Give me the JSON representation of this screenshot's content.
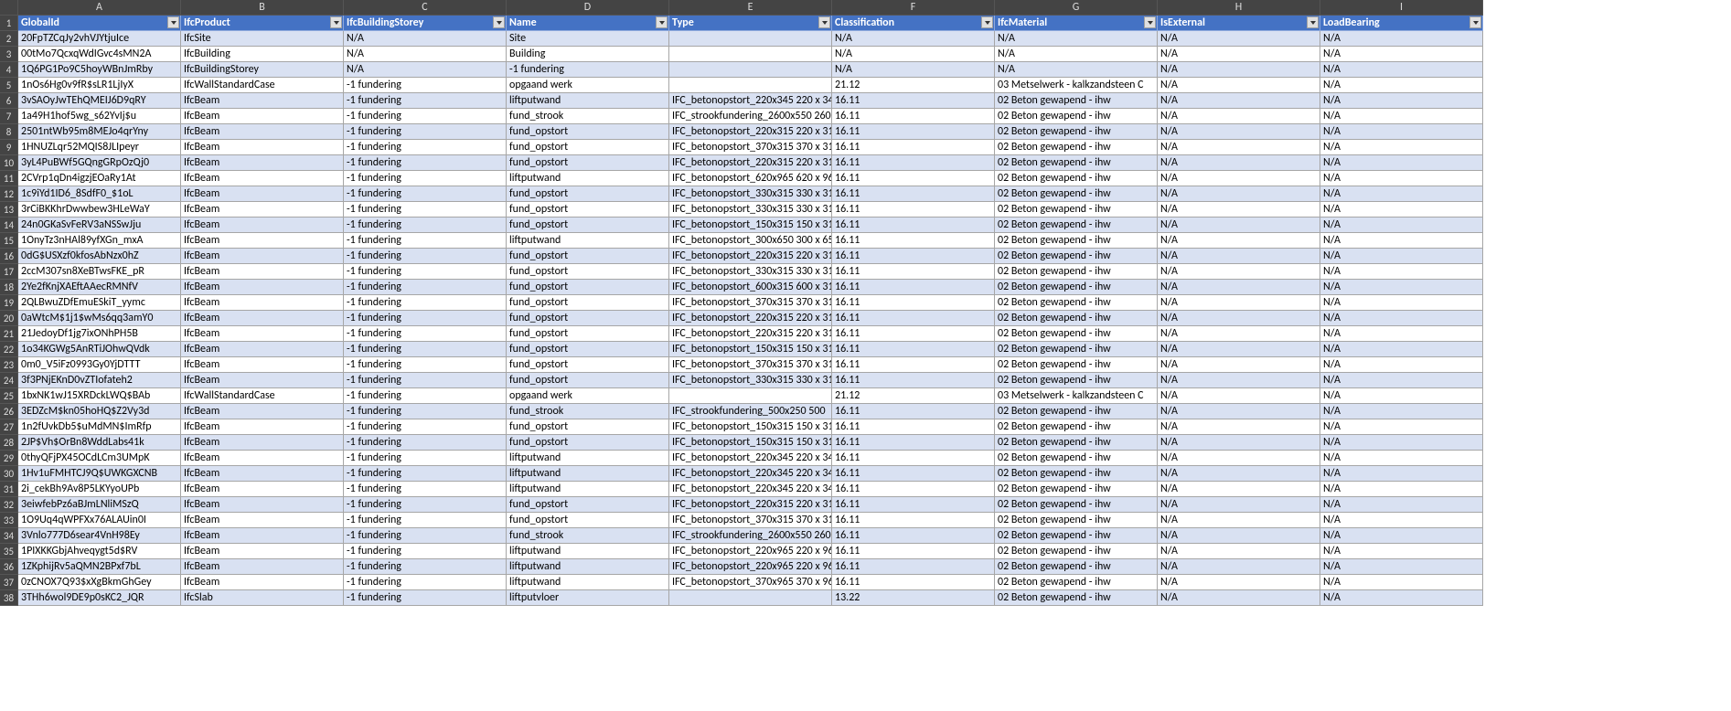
{
  "column_letters": [
    "A",
    "B",
    "C",
    "D",
    "E",
    "F",
    "G",
    "H",
    "I"
  ],
  "headers": [
    "GlobalId",
    "IfcProduct",
    "IfcBuildingStorey",
    "Name",
    "Type",
    "Classification",
    "IfcMaterial",
    "IsExternal",
    "LoadBearing"
  ],
  "rows": [
    {
      "n": 2,
      "v": [
        "20FpTZCqJy2vhVJYtjuIce",
        "IfcSite",
        "N/A",
        "Site",
        "",
        "N/A",
        "N/A",
        "N/A",
        "N/A"
      ]
    },
    {
      "n": 3,
      "v": [
        "00tMo7QcxqWdIGvc4sMN2A",
        "IfcBuilding",
        "N/A",
        "Building",
        "",
        "N/A",
        "N/A",
        "N/A",
        "N/A"
      ]
    },
    {
      "n": 4,
      "v": [
        "1Q6PG1Po9C5hoyWBnJmRby",
        "IfcBuildingStorey",
        "N/A",
        "-1 fundering",
        "",
        "N/A",
        "N/A",
        "N/A",
        "N/A"
      ]
    },
    {
      "n": 5,
      "v": [
        "1nOs6Hg0v9fR$sLR1LjIyX",
        "IfcWallStandardCase",
        "-1 fundering",
        "opgaand werk",
        "",
        "21.12",
        "03 Metselwerk - kalkzandsteen C",
        "N/A",
        "N/A"
      ]
    },
    {
      "n": 6,
      "v": [
        "3vSAOyJwTEhQMEIJ6D9qRY",
        "IfcBeam",
        "-1 fundering",
        "liftputwand",
        "IFC_betonopstort_220x345 220 x 34",
        "16.11",
        "02 Beton gewapend - ihw",
        "N/A",
        "N/A"
      ]
    },
    {
      "n": 7,
      "v": [
        "1a49H1hof5wg_s62YvIj$u",
        "IfcBeam",
        "-1 fundering",
        "fund_strook",
        "IFC_strookfundering_2600x550 260",
        "16.11",
        "02 Beton gewapend - ihw",
        "N/A",
        "N/A"
      ]
    },
    {
      "n": 8,
      "v": [
        "2501ntWb95m8MEJo4qrYny",
        "IfcBeam",
        "-1 fundering",
        "fund_opstort",
        "IFC_betonopstort_220x315 220 x 31",
        "16.11",
        "02 Beton gewapend - ihw",
        "N/A",
        "N/A"
      ]
    },
    {
      "n": 9,
      "v": [
        "1HNUZLqr52MQIS8JLIpeyr",
        "IfcBeam",
        "-1 fundering",
        "fund_opstort",
        "IFC_betonopstort_370x315 370 x 31",
        "16.11",
        "02 Beton gewapend - ihw",
        "N/A",
        "N/A"
      ]
    },
    {
      "n": 10,
      "v": [
        "3yL4PuBWf5GQngGRpOzQj0",
        "IfcBeam",
        "-1 fundering",
        "fund_opstort",
        "IFC_betonopstort_220x315 220 x 31",
        "16.11",
        "02 Beton gewapend - ihw",
        "N/A",
        "N/A"
      ]
    },
    {
      "n": 11,
      "v": [
        "2CVrp1qDn4igzjEOaRy1At",
        "IfcBeam",
        "-1 fundering",
        "liftputwand",
        "IFC_betonopstort_620x965 620 x 96",
        "16.11",
        "02 Beton gewapend - ihw",
        "N/A",
        "N/A"
      ]
    },
    {
      "n": 12,
      "v": [
        "1c9iYd1ID6_8SdfF0_$1oL",
        "IfcBeam",
        "-1 fundering",
        "fund_opstort",
        "IFC_betonopstort_330x315 330 x 31",
        "16.11",
        "02 Beton gewapend - ihw",
        "N/A",
        "N/A"
      ]
    },
    {
      "n": 13,
      "v": [
        "3rCiBKKhrDwwbew3HLeWaY",
        "IfcBeam",
        "-1 fundering",
        "fund_opstort",
        "IFC_betonopstort_330x315 330 x 31",
        "16.11",
        "02 Beton gewapend - ihw",
        "N/A",
        "N/A"
      ]
    },
    {
      "n": 14,
      "v": [
        "24n0GKaSvFeRV3aNSSwJju",
        "IfcBeam",
        "-1 fundering",
        "fund_opstort",
        "IFC_betonopstort_150x315 150 x 31",
        "16.11",
        "02 Beton gewapend - ihw",
        "N/A",
        "N/A"
      ]
    },
    {
      "n": 15,
      "v": [
        "1OnyTz3nHAl89yfXGn_mxA",
        "IfcBeam",
        "-1 fundering",
        "liftputwand",
        "IFC_betonopstort_300x650 300 x 65",
        "16.11",
        "02 Beton gewapend - ihw",
        "N/A",
        "N/A"
      ]
    },
    {
      "n": 16,
      "v": [
        "0dG$USXzf0kfosAbNzx0hZ",
        "IfcBeam",
        "-1 fundering",
        "fund_opstort",
        "IFC_betonopstort_220x315 220 x 31",
        "16.11",
        "02 Beton gewapend - ihw",
        "N/A",
        "N/A"
      ]
    },
    {
      "n": 17,
      "v": [
        "2ccM307sn8XeBTwsFKE_pR",
        "IfcBeam",
        "-1 fundering",
        "fund_opstort",
        "IFC_betonopstort_330x315 330 x 31",
        "16.11",
        "02 Beton gewapend - ihw",
        "N/A",
        "N/A"
      ]
    },
    {
      "n": 18,
      "v": [
        "2Ye2fKnjXAEftAAecRMNfV",
        "IfcBeam",
        "-1 fundering",
        "fund_opstort",
        "IFC_betonopstort_600x315 600 x 31",
        "16.11",
        "02 Beton gewapend - ihw",
        "N/A",
        "N/A"
      ]
    },
    {
      "n": 19,
      "v": [
        "2QLBwuZDfEmuESkiT_yymc",
        "IfcBeam",
        "-1 fundering",
        "fund_opstort",
        "IFC_betonopstort_370x315 370 x 31",
        "16.11",
        "02 Beton gewapend - ihw",
        "N/A",
        "N/A"
      ]
    },
    {
      "n": 20,
      "v": [
        "0aWtcM$1j1$wMs6qq3amY0",
        "IfcBeam",
        "-1 fundering",
        "fund_opstort",
        "IFC_betonopstort_220x315 220 x 31",
        "16.11",
        "02 Beton gewapend - ihw",
        "N/A",
        "N/A"
      ]
    },
    {
      "n": 21,
      "v": [
        "21JedoyDf1jg7ixONhPH5B",
        "IfcBeam",
        "-1 fundering",
        "fund_opstort",
        "IFC_betonopstort_220x315 220 x 31",
        "16.11",
        "02 Beton gewapend - ihw",
        "N/A",
        "N/A"
      ]
    },
    {
      "n": 22,
      "v": [
        "1o34KGWg5AnRTiJOhwQVdk",
        "IfcBeam",
        "-1 fundering",
        "fund_opstort",
        "IFC_betonopstort_150x315 150 x 31",
        "16.11",
        "02 Beton gewapend - ihw",
        "N/A",
        "N/A"
      ]
    },
    {
      "n": 23,
      "v": [
        "0m0_V5iFz0993Gy0YjDTTT",
        "IfcBeam",
        "-1 fundering",
        "fund_opstort",
        "IFC_betonopstort_370x315 370 x 31",
        "16.11",
        "02 Beton gewapend - ihw",
        "N/A",
        "N/A"
      ]
    },
    {
      "n": 24,
      "v": [
        "3f3PNjEKnD0vZTIofateh2",
        "IfcBeam",
        "-1 fundering",
        "fund_opstort",
        "IFC_betonopstort_330x315 330 x 31",
        "16.11",
        "02 Beton gewapend - ihw",
        "N/A",
        "N/A"
      ]
    },
    {
      "n": 25,
      "v": [
        "1bxNK1wJ15XRDckLWQ$BAb",
        "IfcWallStandardCase",
        "-1 fundering",
        "opgaand werk",
        "",
        "21.12",
        "03 Metselwerk - kalkzandsteen C",
        "N/A",
        "N/A"
      ]
    },
    {
      "n": 26,
      "v": [
        "3EDZcM$kn05hoHQ$Z2Vy3d",
        "IfcBeam",
        "-1 fundering",
        "fund_strook",
        "IFC_strookfundering_500x250 500 ",
        "16.11",
        "02 Beton gewapend - ihw",
        "N/A",
        "N/A"
      ]
    },
    {
      "n": 27,
      "v": [
        "1n2fUvkDb5$uMdMN$ImRfp",
        "IfcBeam",
        "-1 fundering",
        "fund_opstort",
        "IFC_betonopstort_150x315 150 x 31",
        "16.11",
        "02 Beton gewapend - ihw",
        "N/A",
        "N/A"
      ]
    },
    {
      "n": 28,
      "v": [
        "2JP$Vh$OrBn8WddLabs41k",
        "IfcBeam",
        "-1 fundering",
        "fund_opstort",
        "IFC_betonopstort_150x315 150 x 31",
        "16.11",
        "02 Beton gewapend - ihw",
        "N/A",
        "N/A"
      ]
    },
    {
      "n": 29,
      "v": [
        "0thyQFjPX45OCdLCm3UMpK",
        "IfcBeam",
        "-1 fundering",
        "liftputwand",
        "IFC_betonopstort_220x345 220 x 34",
        "16.11",
        "02 Beton gewapend - ihw",
        "N/A",
        "N/A"
      ]
    },
    {
      "n": 30,
      "v": [
        "1Hv1uFMHTCJ9Q$UWKGXCNB",
        "IfcBeam",
        "-1 fundering",
        "liftputwand",
        "IFC_betonopstort_220x345 220 x 34",
        "16.11",
        "02 Beton gewapend - ihw",
        "N/A",
        "N/A"
      ]
    },
    {
      "n": 31,
      "v": [
        "2i_cekBh9Av8P5LKYyoUPb",
        "IfcBeam",
        "-1 fundering",
        "liftputwand",
        "IFC_betonopstort_220x345 220 x 34",
        "16.11",
        "02 Beton gewapend - ihw",
        "N/A",
        "N/A"
      ]
    },
    {
      "n": 32,
      "v": [
        "3eiwfebPz6aBJmLNliMSzQ",
        "IfcBeam",
        "-1 fundering",
        "fund_opstort",
        "IFC_betonopstort_220x315 220 x 31",
        "16.11",
        "02 Beton gewapend - ihw",
        "N/A",
        "N/A"
      ]
    },
    {
      "n": 33,
      "v": [
        "1O9Uq4qWPFXx76ALAUin0I",
        "IfcBeam",
        "-1 fundering",
        "fund_opstort",
        "IFC_betonopstort_370x315 370 x 31",
        "16.11",
        "02 Beton gewapend - ihw",
        "N/A",
        "N/A"
      ]
    },
    {
      "n": 34,
      "v": [
        "3Vnlo777D6sear4VnH98Ey",
        "IfcBeam",
        "-1 fundering",
        "fund_strook",
        "IFC_strookfundering_2600x550 260",
        "16.11",
        "02 Beton gewapend - ihw",
        "N/A",
        "N/A"
      ]
    },
    {
      "n": 35,
      "v": [
        "1PIXKKGbjAhveqygt5d$RV",
        "IfcBeam",
        "-1 fundering",
        "liftputwand",
        "IFC_betonopstort_220x965 220 x 96",
        "16.11",
        "02 Beton gewapend - ihw",
        "N/A",
        "N/A"
      ]
    },
    {
      "n": 36,
      "v": [
        "1ZKphijRv5aQMN2BPxf7bL",
        "IfcBeam",
        "-1 fundering",
        "liftputwand",
        "IFC_betonopstort_220x965 220 x 96",
        "16.11",
        "02 Beton gewapend - ihw",
        "N/A",
        "N/A"
      ]
    },
    {
      "n": 37,
      "v": [
        "0zCNOX7Q93$xXgBkmGhGey",
        "IfcBeam",
        "-1 fundering",
        "liftputwand",
        "IFC_betonopstort_370x965 370 x 96",
        "16.11",
        "02 Beton gewapend - ihw",
        "N/A",
        "N/A"
      ]
    },
    {
      "n": 38,
      "v": [
        "3THh6wol9DE9p0sKC2_JQR",
        "IfcSlab",
        "-1 fundering",
        "liftputvloer",
        "",
        "13.22",
        "02 Beton gewapend - ihw",
        "N/A",
        "N/A"
      ]
    }
  ]
}
